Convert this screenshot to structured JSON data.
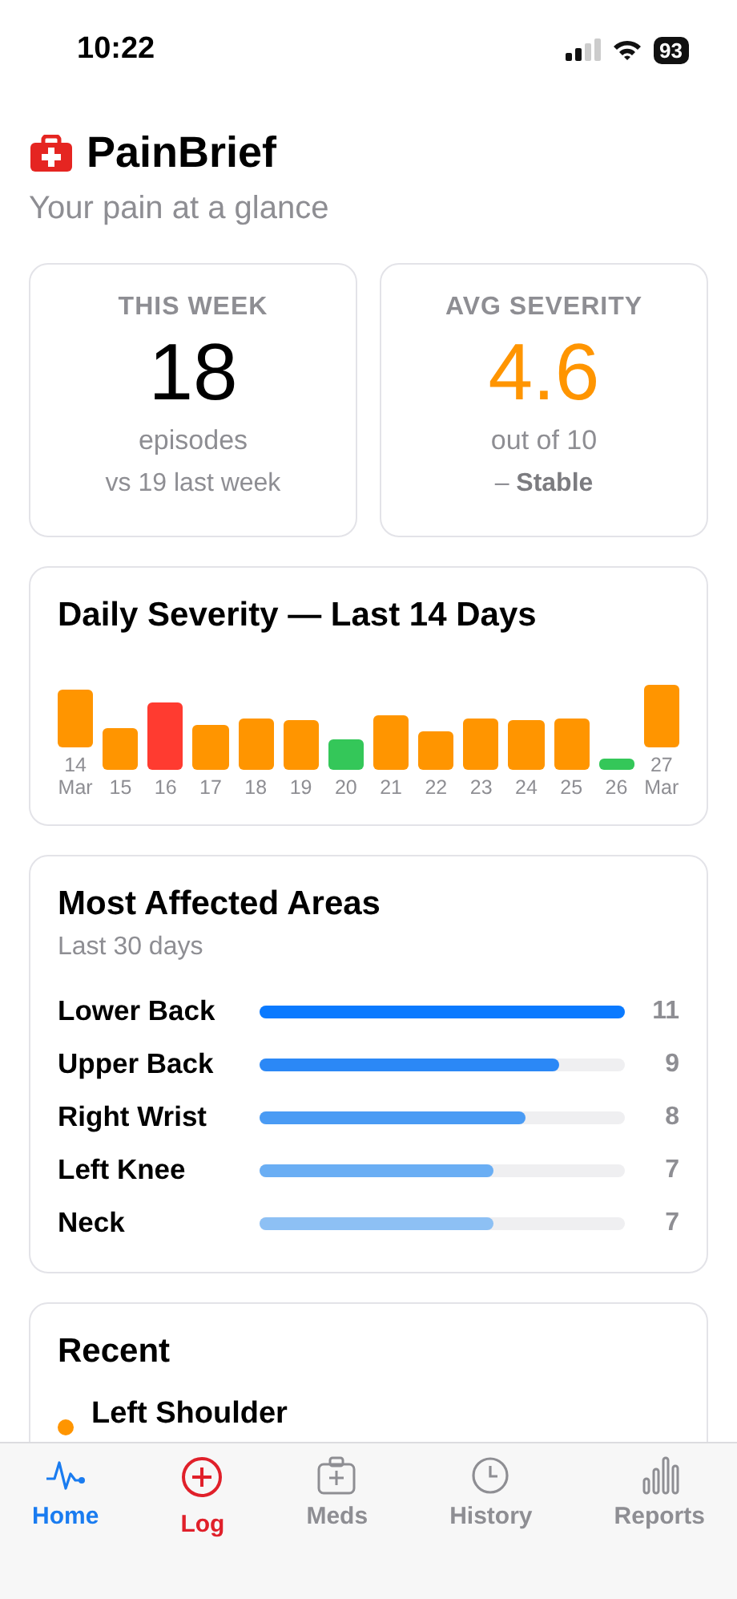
{
  "status_bar": {
    "time": "10:22",
    "battery": "93"
  },
  "header": {
    "title": "PainBrief",
    "subtitle": "Your pain at a glance"
  },
  "stats": [
    {
      "label": "THIS WEEK",
      "value": "18",
      "color": "#000000",
      "unit": "episodes",
      "note": "vs 19 last week"
    },
    {
      "label": "AVG SEVERITY",
      "value": "4.6",
      "color": "#ff9500",
      "unit": "out of 10",
      "note": "– **Stable**"
    }
  ],
  "daily": {
    "title": "Daily Severity — Last 14 Days",
    "days": [
      {
        "day": "14",
        "month": "Mar",
        "color": "#ff9500"
      },
      {
        "day": "15",
        "color": "#ff9500"
      },
      {
        "day": "16",
        "color": "#ff3b30"
      },
      {
        "day": "17",
        "color": "#ff9500"
      },
      {
        "day": "18",
        "color": "#ff9500"
      },
      {
        "day": "19",
        "color": "#ff9500"
      },
      {
        "day": "20",
        "color": "#34c759"
      },
      {
        "day": "21",
        "color": "#ff9500"
      },
      {
        "day": "22",
        "color": "#ff9500"
      },
      {
        "day": "23",
        "color": "#ff9500"
      },
      {
        "day": "24",
        "color": "#ff9500"
      },
      {
        "day": "25",
        "color": "#ff9500"
      },
      {
        "day": "26",
        "color": "#34c759"
      },
      {
        "day": "27",
        "month": "Mar",
        "color": "#ff9500"
      }
    ]
  },
  "areas": {
    "title": "Most Affected Areas",
    "subtitle": "Last 30 days",
    "items": [
      {
        "name": "Lower Back",
        "count": "11",
        "level": 1,
        "color": "#0a7aff"
      },
      {
        "name": "Upper Back",
        "count": "9",
        "level": 0.82,
        "color": "#2b88f6"
      },
      {
        "name": "Right Wrist",
        "count": "8",
        "level": 0.73,
        "color": "#4a9bf4"
      },
      {
        "name": "Left Knee",
        "count": "7",
        "level": 0.64,
        "color": "#6aaef4"
      },
      {
        "name": "Neck",
        "count": "7",
        "level": 0.64,
        "color": "#8dc0f4"
      }
    ]
  },
  "recent": {
    "title": "Recent",
    "items": [
      {
        "name": "Left Shoulder",
        "color": "#ff9500"
      }
    ]
  },
  "tabs": [
    {
      "label": "Home",
      "kind": "tab",
      "selected": true
    },
    {
      "label": "Log",
      "kind": "action",
      "selected": false
    },
    {
      "label": "Meds",
      "kind": "tab",
      "selected": false
    },
    {
      "label": "History",
      "kind": "tab",
      "selected": false
    },
    {
      "label": "Reports",
      "kind": "tab",
      "selected": false
    }
  ]
}
